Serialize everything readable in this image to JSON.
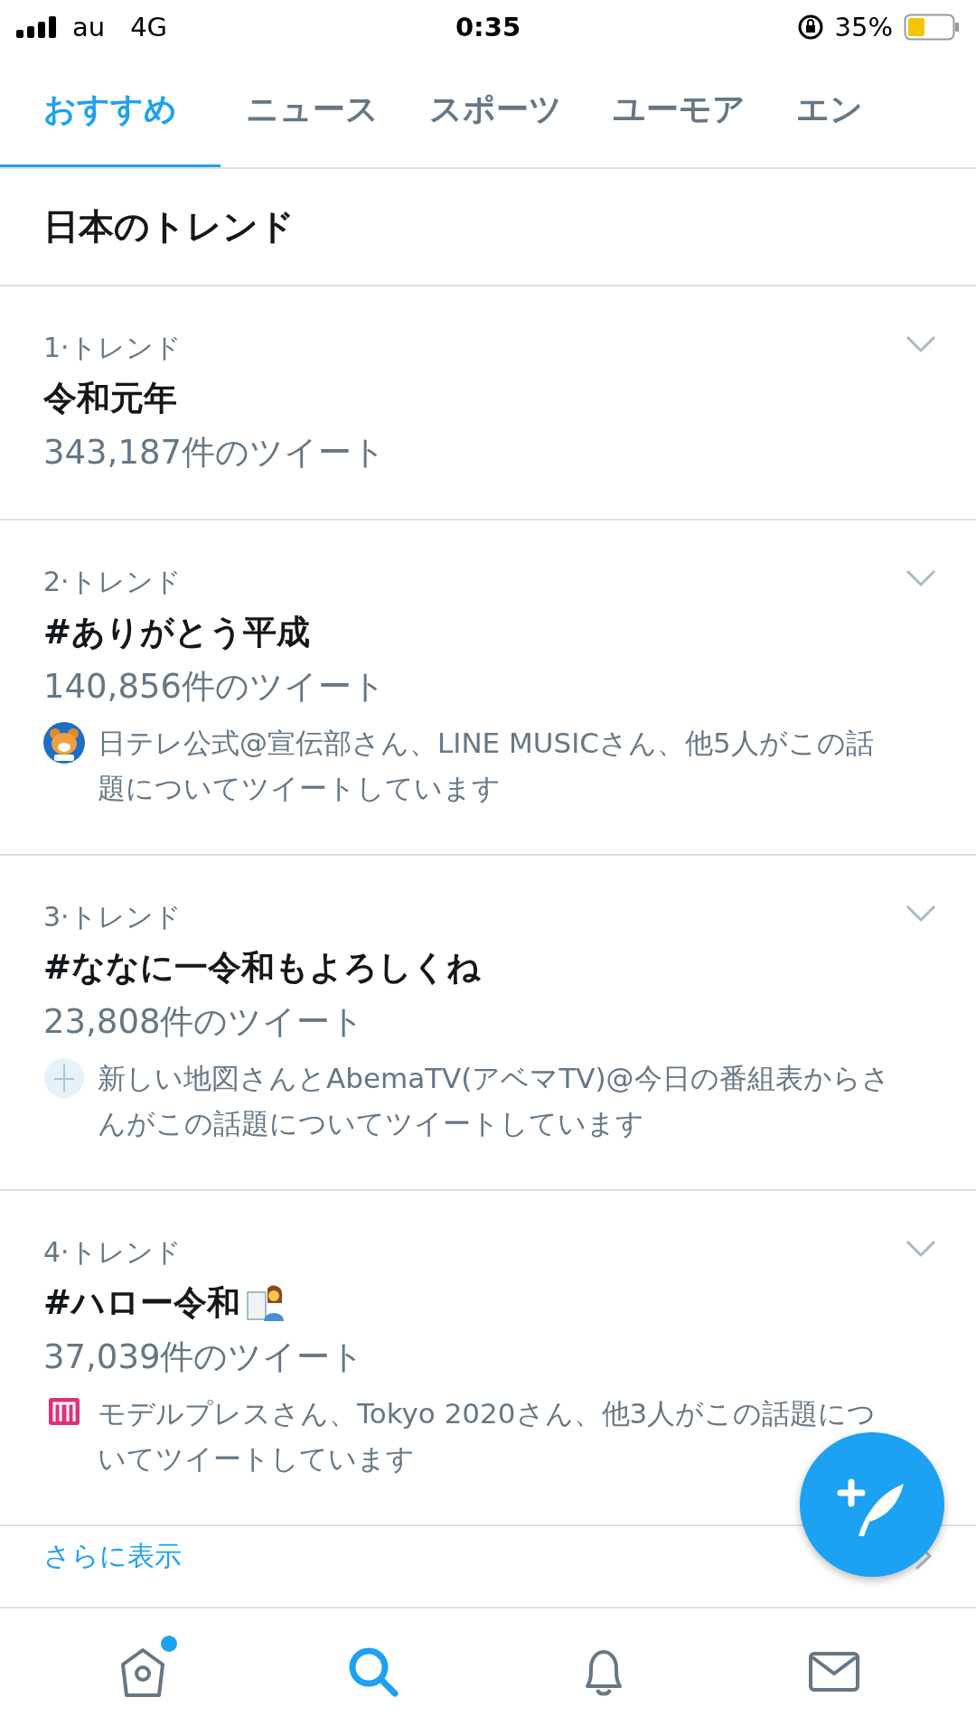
{
  "status_bar": {
    "carrier": "au",
    "network": "4G",
    "time": "0:35",
    "battery": "35%"
  },
  "tabs": [
    {
      "label": "おすすめ",
      "selected": true
    },
    {
      "label": "ニュース",
      "selected": false
    },
    {
      "label": "スポーツ",
      "selected": false
    },
    {
      "label": "ユーモア",
      "selected": false
    },
    {
      "label": "エン",
      "selected": false
    }
  ],
  "section_title": "日本のトレンド",
  "trends": [
    {
      "rank": "1·トレンド",
      "title": "令和元年",
      "count": "343,187件のツイート"
    },
    {
      "rank": "2·トレンド",
      "title": "#ありがとう平成",
      "count": "140,856件のツイート",
      "avatar": {
        "kind": "bear"
      },
      "context": "日テレ公式@宣伝部さん、LINE MUSICさん、他5人がこの話題についてツイートしています"
    },
    {
      "rank": "3·トレンド",
      "title": "#ななに一令和もよろしくね",
      "count": "23,808件のツイート",
      "avatar": {
        "kind": "sketch"
      },
      "context": "新しい地図さんとAbemaTV(アベマTV)@今日の番組表からさんがこの話題についてツイートしています"
    },
    {
      "rank": "4·トレンド",
      "title": "#ハロー令和",
      "emoji": true,
      "count": "37,039件のツイート",
      "avatar": {
        "kind": "mark"
      },
      "context": "モデルプレスさん、Tokyo 2020さん、他3人がこの話題についてツイートしています"
    }
  ],
  "show_more": "さらに表示",
  "nav": [
    {
      "kind": "home",
      "selected": false,
      "badge": true
    },
    {
      "kind": "search",
      "selected": true,
      "badge": false
    },
    {
      "kind": "notifications",
      "selected": false,
      "badge": false
    },
    {
      "kind": "messages",
      "selected": false,
      "badge": false
    }
  ]
}
